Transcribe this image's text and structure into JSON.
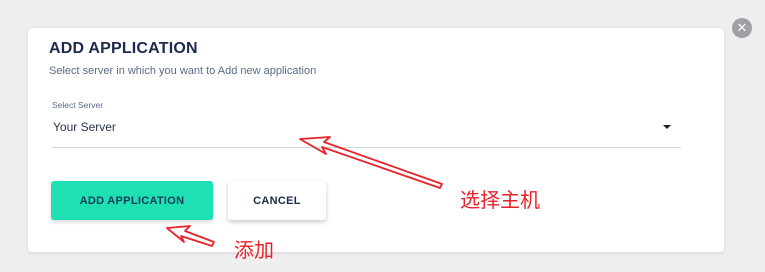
{
  "modal": {
    "title": "ADD APPLICATION",
    "subtitle": "Select server in which you want to Add new application",
    "select_label": "Select Server",
    "select_value": "Your Server",
    "add_label": "ADD APPLICATION",
    "cancel_label": "CANCEL"
  },
  "annotations": {
    "server_note": "选择主机",
    "add_note": "添加"
  },
  "icons": {
    "close": "close-icon",
    "dropdown": "caret-down-icon",
    "arrow": "red-arrow-annotation"
  },
  "colors": {
    "accent": "#1ee0b2",
    "title": "#1d2a4d",
    "annotation": "#e8232a",
    "close_button": "#9ea0a5"
  }
}
